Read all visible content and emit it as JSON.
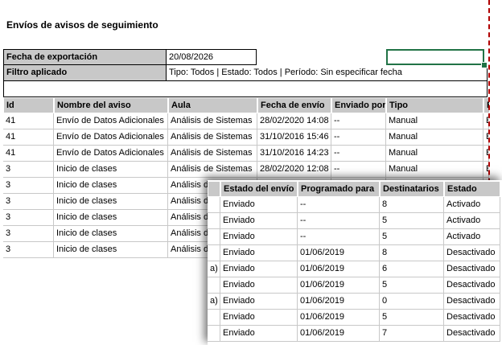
{
  "title": "Envíos de avisos de seguimiento",
  "export": {
    "label": "Fecha de exportación",
    "value": "20/08/2026"
  },
  "filter": {
    "label": "Filtro aplicado",
    "value": "Tipo: Todos | Estado: Todos | Período: Sin especificar fecha"
  },
  "main_table": {
    "headers": [
      "Id",
      "Nombre del aviso",
      "Aula",
      "Fecha de envío",
      "Enviado por",
      "Tipo",
      "E"
    ],
    "rows": [
      [
        "41",
        "Envío de Datos Adicionales",
        "Análisis de Sistemas",
        "28/02/2020 14:08",
        "--",
        "Manual",
        "E"
      ],
      [
        "41",
        "Envío de Datos Adicionales",
        "Análisis de Sistemas",
        "31/10/2016 15:46",
        "--",
        "Manual",
        "E"
      ],
      [
        "41",
        "Envío de Datos Adicionales",
        "Análisis de Sistemas",
        "31/10/2016 14:23",
        "--",
        "Manual",
        "E"
      ],
      [
        "3",
        "Inicio de clases",
        "Análisis de Sistemas",
        "28/02/2020 12:08",
        "--",
        "Manual",
        "E"
      ],
      [
        "3",
        "Inicio de clases",
        "Análisis d",
        "",
        "",
        "",
        ""
      ],
      [
        "3",
        "Inicio de clases",
        "Análisis d",
        "",
        "",
        "",
        ""
      ],
      [
        "3",
        "Inicio de clases",
        "Análisis d",
        "",
        "",
        "",
        ""
      ],
      [
        "3",
        "Inicio de clases",
        "Análisis d",
        "",
        "",
        "",
        ""
      ],
      [
        "3",
        "Inicio de clases",
        "Análisis d",
        "",
        "",
        "",
        ""
      ]
    ]
  },
  "overlay_table": {
    "headers": [
      "",
      "Estado del envío",
      "Programado para",
      "Destinatarios",
      "Estado"
    ],
    "rows": [
      [
        "",
        "Enviado",
        "--",
        "8",
        "Activado"
      ],
      [
        "",
        "Enviado",
        "--",
        "5",
        "Activado"
      ],
      [
        "",
        "Enviado",
        "--",
        "5",
        "Activado"
      ],
      [
        "",
        "Enviado",
        "01/06/2019",
        "8",
        "Desactivado"
      ],
      [
        "a)",
        "Enviado",
        "01/06/2019",
        "6",
        "Desactivado"
      ],
      [
        "",
        "Enviado",
        "01/06/2019",
        "5",
        "Desactivado"
      ],
      [
        "a)",
        "Enviado",
        "01/06/2019",
        "0",
        "Desactivado"
      ],
      [
        "",
        "Enviado",
        "01/06/2019",
        "5",
        "Desactivado"
      ],
      [
        "",
        "Enviado",
        "01/06/2019",
        "7",
        "Desactivado"
      ]
    ]
  }
}
